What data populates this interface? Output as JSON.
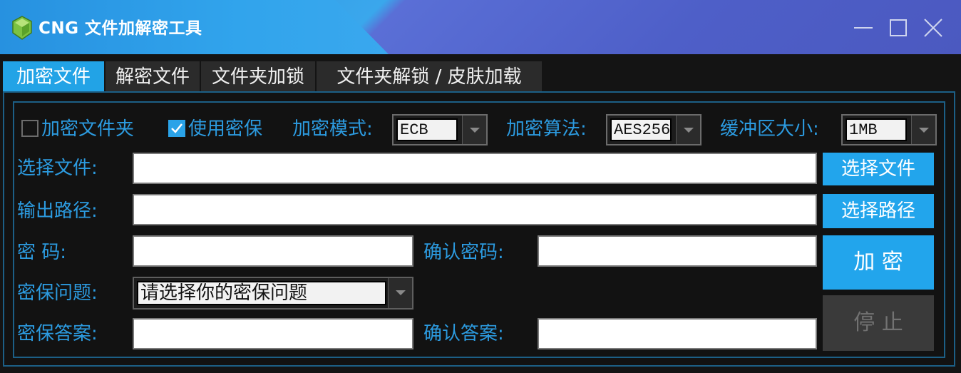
{
  "window": {
    "title": "CNG 文件加解密工具",
    "icon": "leaf-shield-icon"
  },
  "tabs": [
    {
      "label": "加密文件",
      "active": true
    },
    {
      "label": "解密文件",
      "active": false
    },
    {
      "label": "文件夹加锁",
      "active": false
    },
    {
      "label": "文件夹解锁 / 皮肤加载",
      "active": false
    }
  ],
  "options": {
    "encrypt_folder": {
      "label": "加密文件夹",
      "checked": false
    },
    "use_security": {
      "label": "使用密保",
      "checked": true
    },
    "mode": {
      "label": "加密模式:",
      "value": "ECB"
    },
    "algorithm": {
      "label": "加密算法:",
      "value": "AES256"
    },
    "buffer": {
      "label": "缓冲区大小:",
      "value": "1MB"
    }
  },
  "form": {
    "select_file_label": "选择文件:",
    "select_file_value": "",
    "output_path_label": "输出路径:",
    "output_path_value": "",
    "password_label": "密 码:",
    "confirm_password_label": "确认密码:",
    "question_label": "密保问题:",
    "question_placeholder": "请选择你的密保问题",
    "answer_label": "密保答案:",
    "confirm_answer_label": "确认答案:"
  },
  "buttons": {
    "select_file": "选择文件",
    "select_path": "选择路径",
    "encrypt": "加 密",
    "stop": "停 止"
  },
  "colors": {
    "accent": "#22a5ec",
    "label": "#2c9be0",
    "background": "#141414",
    "border": "#1c5f86"
  }
}
